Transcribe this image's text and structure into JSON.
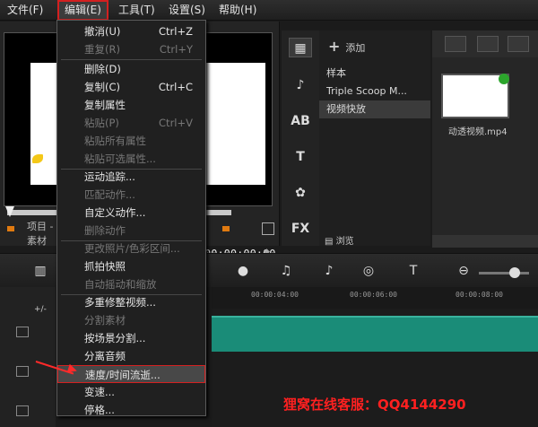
{
  "menubar": {
    "items": [
      {
        "label": "文件(F)"
      },
      {
        "label": "编辑(E)"
      },
      {
        "label": "工具(T)"
      },
      {
        "label": "设置(S)"
      },
      {
        "label": "帮助(H)"
      }
    ]
  },
  "preview": {
    "timecode": "00:00:00:00",
    "timecode_arrows": "◆",
    "label_project": "项目 -",
    "label_clip": "素材"
  },
  "library": {
    "add_label": "添加",
    "items": [
      {
        "label": "样本"
      },
      {
        "label": "Triple Scoop M..."
      },
      {
        "label": "视频快放"
      }
    ],
    "browse_label": "浏览",
    "thumb_name": "动透视频.mp4",
    "tools": [
      "♪",
      "AB",
      "T",
      "FX"
    ]
  },
  "timeline": {
    "ticks": [
      "00:00:04:00",
      "00:00:06:00",
      "00:00:08:00"
    ],
    "head_sign": "+/-"
  },
  "edit_menu": {
    "items": [
      {
        "label": "撤消(U)",
        "shortcut": "Ctrl+Z",
        "disabled": false
      },
      {
        "label": "重复(R)",
        "shortcut": "Ctrl+Y",
        "disabled": true
      },
      {
        "label": "删除(D)",
        "shortcut": "",
        "disabled": false
      },
      {
        "label": "复制(C)",
        "shortcut": "Ctrl+C",
        "disabled": false
      },
      {
        "label": "复制属性",
        "shortcut": "",
        "disabled": false
      },
      {
        "label": "粘贴(P)",
        "shortcut": "Ctrl+V",
        "disabled": true
      },
      {
        "label": "粘贴所有属性",
        "shortcut": "",
        "disabled": true
      },
      {
        "label": "粘贴可选属性...",
        "shortcut": "",
        "disabled": true
      },
      {
        "label": "运动追踪...",
        "shortcut": "",
        "disabled": false
      },
      {
        "label": "匹配动作...",
        "shortcut": "",
        "disabled": true
      },
      {
        "label": "自定义动作...",
        "shortcut": "",
        "disabled": false
      },
      {
        "label": "删除动作",
        "shortcut": "",
        "disabled": true
      },
      {
        "label": "更改照片/色彩区间...",
        "shortcut": "",
        "disabled": true
      },
      {
        "label": "抓拍快照",
        "shortcut": "",
        "disabled": false
      },
      {
        "label": "自动摇动和缩放",
        "shortcut": "",
        "disabled": true
      },
      {
        "label": "多重修整视频...",
        "shortcut": "",
        "disabled": false
      },
      {
        "label": "分割素材",
        "shortcut": "",
        "disabled": true
      },
      {
        "label": "按场景分割...",
        "shortcut": "",
        "disabled": false
      },
      {
        "label": "分离音频",
        "shortcut": "",
        "disabled": false
      },
      {
        "label": "速度/时间流逝...",
        "shortcut": "",
        "disabled": false
      },
      {
        "label": "变速...",
        "shortcut": "",
        "disabled": false
      },
      {
        "label": "停格...",
        "shortcut": "",
        "disabled": false
      }
    ],
    "highlighted_index": 19
  },
  "watermark": "狸窝在线客服：QQ4144290",
  "colors": {
    "accent_red": "#d42020",
    "clip_teal": "#1a8c78"
  }
}
